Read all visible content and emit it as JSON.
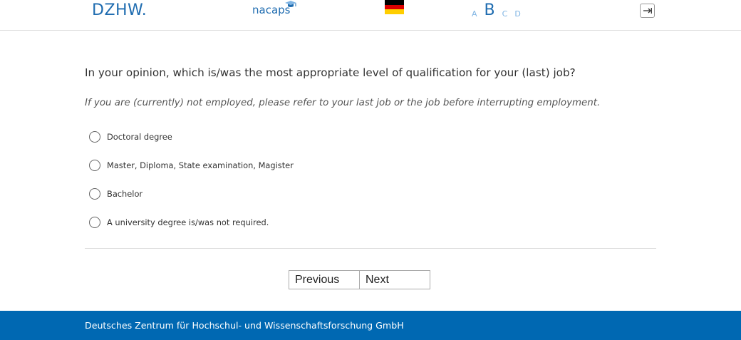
{
  "header": {
    "logo_dzhw": "DZHW.",
    "logo_nacaps": "nacaps",
    "language_flag": "german-flag",
    "font_sizes": [
      "A",
      "B",
      "C",
      "D"
    ],
    "font_size_selected": "B",
    "logout_icon": "logout-icon",
    "colors": {
      "brand": "#1f6cb0",
      "brand_light": "#7fb4e3"
    }
  },
  "question": {
    "text": "In your opinion, which is/was the most appropriate level of qualification for your (last) job?",
    "instruction": "If you are (currently) not employed, please refer to your last job or the job before interrupting employment.",
    "options": [
      {
        "label": "Doctoral degree",
        "selected": false
      },
      {
        "label": "Master, Diploma, State examination, Magister",
        "selected": false
      },
      {
        "label": "Bachelor",
        "selected": false
      },
      {
        "label": "A university degree is/was not required.",
        "selected": false
      }
    ]
  },
  "navigation": {
    "previous_label": "Previous",
    "next_label": "Next"
  },
  "footer": {
    "text": "Deutsches Zentrum für Hochschul- und Wissenschaftsforschung GmbH",
    "background": "#0068b2"
  }
}
